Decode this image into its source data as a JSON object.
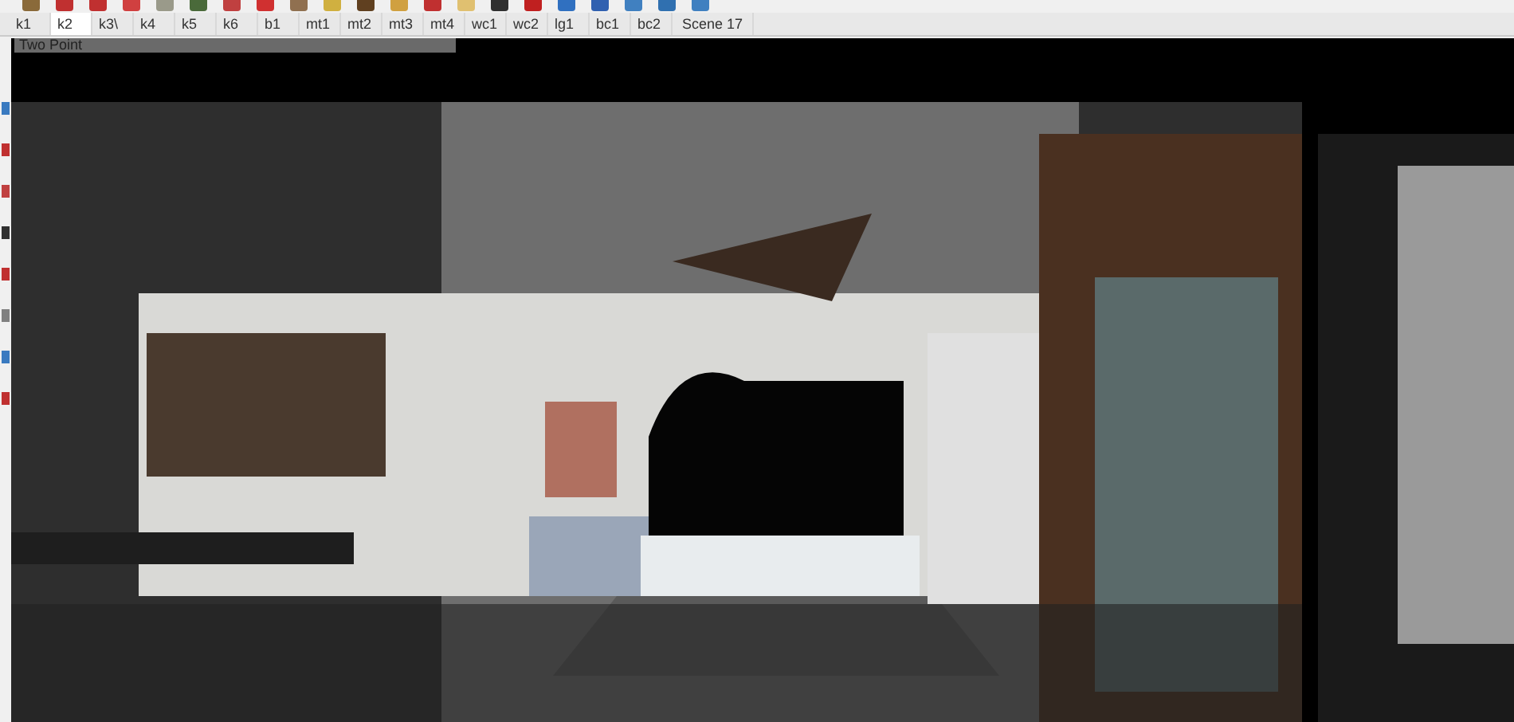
{
  "scene_tabs": [
    {
      "label": "k1",
      "selected": false
    },
    {
      "label": "k2",
      "selected": true
    },
    {
      "label": "k3\\",
      "selected": false
    },
    {
      "label": "k4",
      "selected": false
    },
    {
      "label": "k5",
      "selected": false
    },
    {
      "label": "k6",
      "selected": false
    },
    {
      "label": "b1",
      "selected": false
    },
    {
      "label": "mt1",
      "selected": false
    },
    {
      "label": "mt2",
      "selected": false
    },
    {
      "label": "mt3",
      "selected": false
    },
    {
      "label": "mt4",
      "selected": false
    },
    {
      "label": "wc1",
      "selected": false
    },
    {
      "label": "wc2",
      "selected": false
    },
    {
      "label": "lg1",
      "selected": false
    },
    {
      "label": "bc1",
      "selected": false
    },
    {
      "label": "bc2",
      "selected": false
    },
    {
      "label": "Scene 17",
      "selected": false
    }
  ],
  "viewport": {
    "camera_label": "Two Point"
  }
}
